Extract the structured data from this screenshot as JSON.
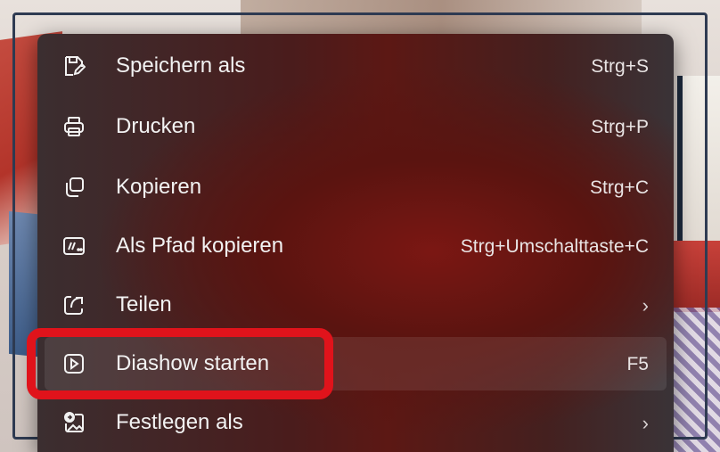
{
  "menu": {
    "items": [
      {
        "label": "Speichern als",
        "shortcut": "Strg+S",
        "icon": "save-as-icon"
      },
      {
        "label": "Drucken",
        "shortcut": "Strg+P",
        "icon": "printer-icon"
      },
      {
        "label": "Kopieren",
        "shortcut": "Strg+C",
        "icon": "copy-icon"
      },
      {
        "label": "Als Pfad kopieren",
        "shortcut": "Strg+Umschalttaste+C",
        "icon": "copy-path-icon"
      },
      {
        "label": "Teilen",
        "shortcut": "›",
        "icon": "share-icon"
      },
      {
        "label": "Diashow starten",
        "shortcut": "F5",
        "icon": "slideshow-play-icon"
      },
      {
        "label": "Festlegen als",
        "shortcut": "›",
        "icon": "set-as-icon"
      }
    ]
  },
  "colors": {
    "highlight": "#e0131b",
    "menu_text": "#f2f2f2"
  }
}
